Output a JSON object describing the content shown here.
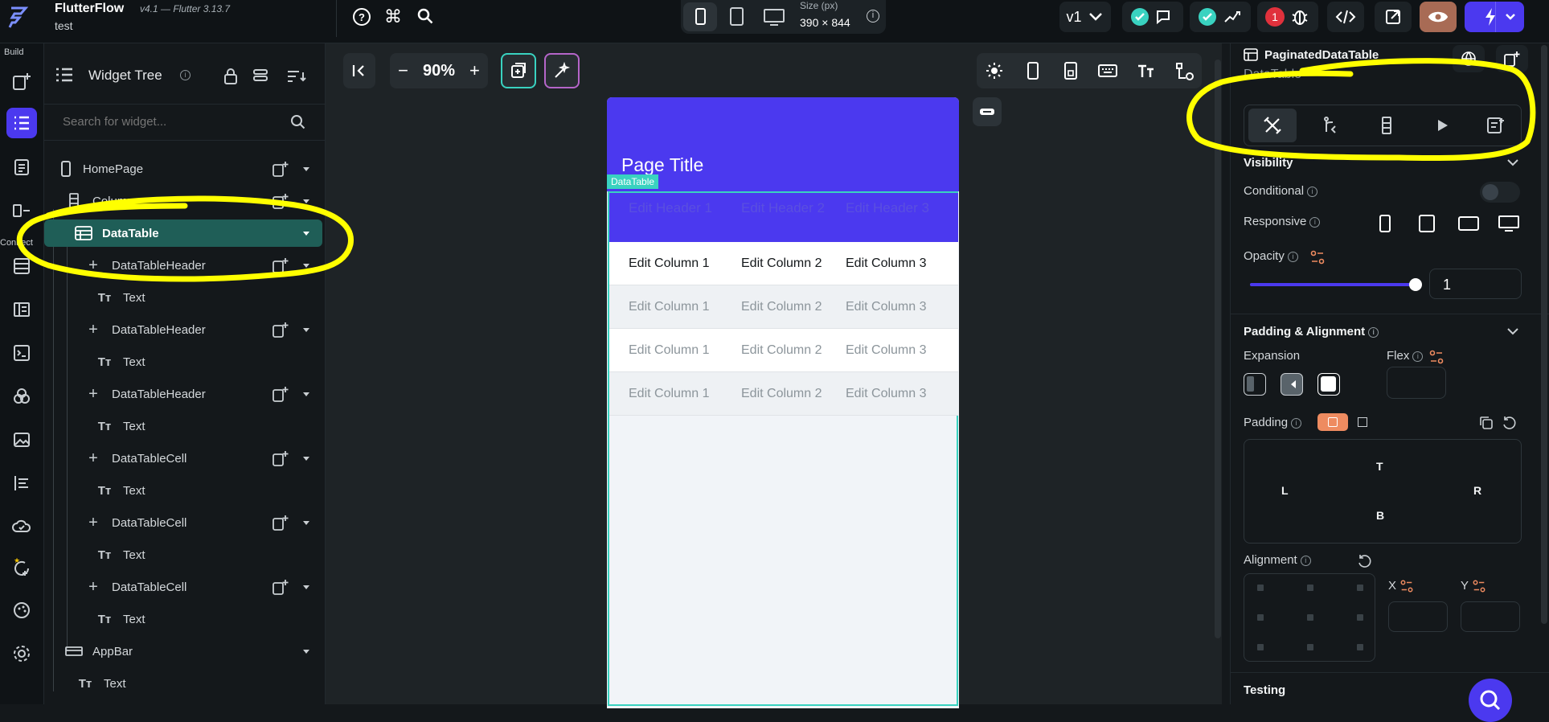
{
  "app": {
    "name": "FlutterFlow",
    "version": "v4.1 — Flutter 3.13.7",
    "project": "test"
  },
  "topbar": {
    "size_label": "Size (px)",
    "size_value": "390 × 844",
    "version_select": "v1",
    "error_count": "1"
  },
  "rail": {
    "build_label": "Build",
    "connect_label": "Connect"
  },
  "tree": {
    "title": "Widget Tree",
    "search_placeholder": "Search for widget...",
    "rows": [
      {
        "label": "HomePage",
        "icon": "phone-icon"
      },
      {
        "label": "Column",
        "icon": "column-icon"
      },
      {
        "label": "DataTable",
        "icon": "table-icon"
      },
      {
        "label": "DataTableHeader",
        "icon": "plus-icon"
      },
      {
        "label": "Text",
        "icon": "text-icon"
      },
      {
        "label": "DataTableHeader",
        "icon": "plus-icon"
      },
      {
        "label": "Text",
        "icon": "text-icon"
      },
      {
        "label": "DataTableHeader",
        "icon": "plus-icon"
      },
      {
        "label": "Text",
        "icon": "text-icon"
      },
      {
        "label": "DataTableCell",
        "icon": "plus-icon"
      },
      {
        "label": "Text",
        "icon": "text-icon"
      },
      {
        "label": "DataTableCell",
        "icon": "plus-icon"
      },
      {
        "label": "Text",
        "icon": "text-icon"
      },
      {
        "label": "DataTableCell",
        "icon": "plus-icon"
      },
      {
        "label": "Text",
        "icon": "text-icon"
      },
      {
        "label": "AppBar",
        "icon": "appbar-icon"
      },
      {
        "label": "Text",
        "icon": "text-icon"
      }
    ]
  },
  "canvas": {
    "zoom": "90%",
    "page_title": "Page Title",
    "datatable_tag": "DataTable",
    "headers": [
      "Edit Header 1",
      "Edit Header 2",
      "Edit Header 3"
    ],
    "rows": [
      [
        "Edit Column 1",
        "Edit Column 2",
        "Edit Column 3"
      ],
      [
        "Edit Column 1",
        "Edit Column 2",
        "Edit Column 3"
      ],
      [
        "Edit Column 1",
        "Edit Column 2",
        "Edit Column 3"
      ],
      [
        "Edit Column 1",
        "Edit Column 2",
        "Edit Column 3"
      ]
    ]
  },
  "props": {
    "widget_name": "PaginatedDataTable",
    "widget_subtitle": "DataTable",
    "visibility_label": "Visibility",
    "conditional_label": "Conditional",
    "responsive_label": "Responsive",
    "opacity_label": "Opacity",
    "opacity_value": "1",
    "opacity_level": 1.0,
    "padding_alignment_label": "Padding & Alignment",
    "expansion_label": "Expansion",
    "flex_label": "Flex",
    "padding_label": "Padding",
    "pad_t": "T",
    "pad_l": "L",
    "pad_r": "R",
    "pad_b": "B",
    "alignment_label": "Alignment",
    "x_label": "X",
    "y_label": "Y",
    "testing_label": "Testing"
  },
  "colors": {
    "accent": "#4b39ef",
    "highlight": "#ffff00",
    "teal": "#39d2c0",
    "selected_row": "#1f5e57"
  }
}
